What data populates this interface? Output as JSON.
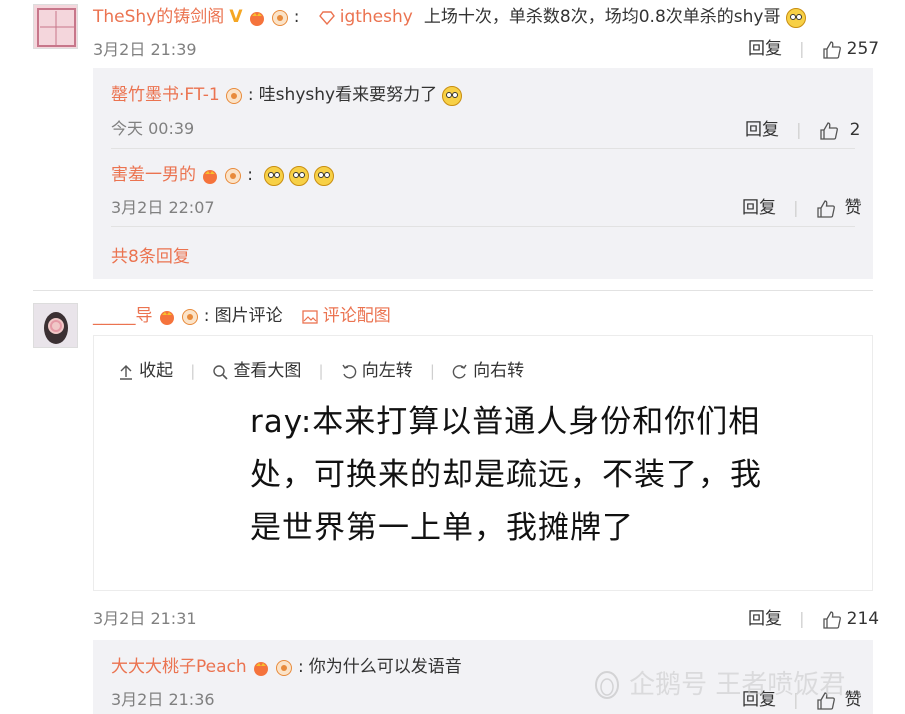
{
  "comments": [
    {
      "user": "TheShy的铸剑阁",
      "mention": "igtheshy",
      "text": "上场十次，单杀数8次，场均0.8次单杀的shy哥",
      "time": "3月2日 21:39",
      "reply_label": "回复",
      "likes": "257",
      "replies": [
        {
          "user": "罄竹墨书·FT-1",
          "text": "哇shyshy看来要努力了",
          "time": "今天 00:39",
          "reply_label": "回复",
          "likes": "2"
        },
        {
          "user": "害羞一男的",
          "text": "",
          "time": "3月2日 22:07",
          "reply_label": "回复",
          "likes": "赞"
        }
      ],
      "more_replies": "共8条回复"
    },
    {
      "user": "_____导",
      "text": "图片评论",
      "pic_link": "评论配图",
      "toolbar": {
        "collapse": "收起",
        "view_large": "查看大图",
        "rotate_left": "向左转",
        "rotate_right": "向右转"
      },
      "image_text": [
        "ray:本来打算以普通人身份和你们相",
        "处，可换来的却是疏远，不装了，我",
        "是世界第一上单，我摊牌了"
      ],
      "time": "3月2日 21:31",
      "reply_label": "回复",
      "likes": "214",
      "replies": [
        {
          "user": "大大大桃子Peach",
          "text": "你为什么可以发语音",
          "time": "3月2日 21:36",
          "reply_label": "回复",
          "likes": "赞"
        }
      ]
    }
  ],
  "watermark": "企鹅号 王者喷饭君",
  "colors": {
    "name": "#eb7350",
    "reply_bg": "#f2f2f5",
    "time": "#808080"
  }
}
